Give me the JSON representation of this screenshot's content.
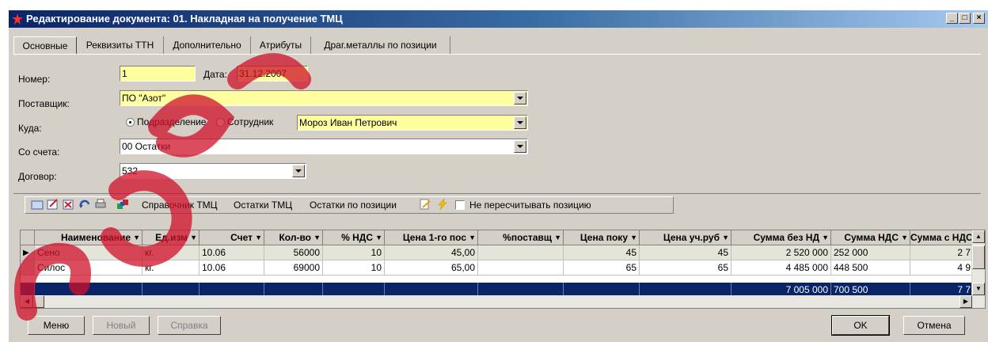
{
  "window": {
    "title": "Редактирование документа: 01. Накладная на получение ТМЦ",
    "controls": [
      "_",
      "□",
      "×"
    ]
  },
  "tabs": [
    {
      "label": "Основные",
      "active": true
    },
    {
      "label": "Реквизиты ТТН"
    },
    {
      "label": "Дополнительно"
    },
    {
      "label": "Атрибуты"
    },
    {
      "label": "Драг.металлы по позиции"
    }
  ],
  "form": {
    "number_label": "Номер:",
    "number_value": "1",
    "date_label": "Дата:",
    "date_value": "31.12.2007",
    "supplier_label": "Поставщик:",
    "supplier_value": "ПО \"Азот\"",
    "dest_label": "Куда:",
    "radio_division": "Подразделение",
    "radio_employee": "Сотрудник",
    "employee_value": "Мороз  Иван  Петрович",
    "account_label": "Со счета:",
    "account_value": "00 Остатки",
    "contract_label": "Договор:",
    "contract_value": "532"
  },
  "toolbar": {
    "ref_tmc": "Справочник ТМЦ",
    "rest_tmc": "Остатки ТМЦ",
    "rest_pos": "Остатки по позиции",
    "no_recalc": "Не пересчитывать позицию"
  },
  "grid": {
    "headers": [
      "Наименование",
      "Ед.изм",
      "Счет",
      "Кол-во",
      "% НДС",
      "Цена 1-го пос",
      "%поставщ",
      "Цена поку",
      "Цена уч.руб",
      "Сумма без НД",
      "Сумма НДС",
      "Сумма с НДС"
    ],
    "rows": [
      [
        "Сено",
        "кг.",
        "10.06",
        "56000",
        "10",
        "45,00",
        "",
        "45",
        "45",
        "2 520 000",
        "252 000",
        "2 7"
      ],
      [
        "Силос",
        "кг.",
        "10.06",
        "69000",
        "10",
        "65,00",
        "",
        "65",
        "65",
        "4 485 000",
        "448 500",
        "4 9"
      ]
    ],
    "totals": [
      "7 005 000",
      "700 500",
      "7 7"
    ]
  },
  "buttons": {
    "menu": "Меню",
    "new": "Новый",
    "help": "Справка",
    "ok": "OK",
    "cancel": "Отмена"
  },
  "colors": {
    "title_start": "#0a246a",
    "field_yellow": "#ffffa0",
    "total_row": "#0a246a",
    "watermark": "#d0102a"
  }
}
